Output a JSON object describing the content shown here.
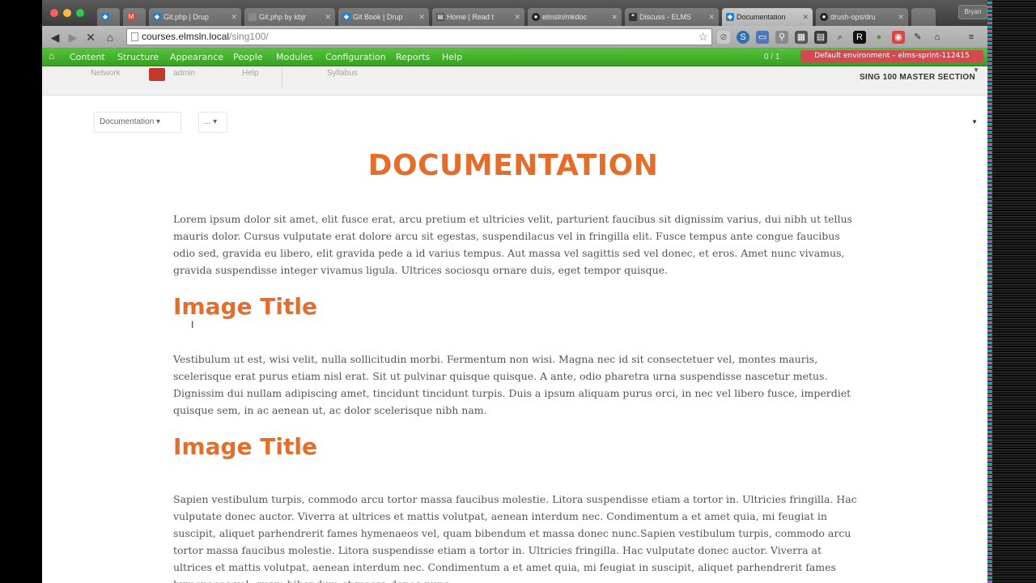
{
  "browser": {
    "tabs": [
      {
        "label": "",
        "favicon": "drupal-icon",
        "color": "#2a7fbf"
      },
      {
        "label": "",
        "favicon": "gmail-icon",
        "color": "#d14836"
      },
      {
        "label": "Git.php | Drup",
        "favicon": "drupal-icon",
        "color": "#2a7fbf"
      },
      {
        "label": "Git.php by kbjr",
        "favicon": "page-icon",
        "color": "#888888"
      },
      {
        "label": "Git Book | Drup",
        "favicon": "drupal-icon",
        "color": "#2a7fbf"
      },
      {
        "label": "Home | Read t",
        "favicon": "book-icon",
        "color": "#555555"
      },
      {
        "label": "elmsln/mkdoc",
        "favicon": "github-icon",
        "color": "#222222"
      },
      {
        "label": "Discuss - ELMS",
        "favicon": "discuss-icon",
        "color": "#333333"
      },
      {
        "label": "Documentation",
        "favicon": "drupal-icon",
        "color": "#2a7fbf"
      },
      {
        "label": "drush-ops/dru",
        "favicon": "github-icon",
        "color": "#222222"
      }
    ],
    "user_chip": "Bryan",
    "url_host": "courses.elmsln.local",
    "url_path": "/sing100/"
  },
  "admin_menu": {
    "items": [
      "Content",
      "Structure",
      "Appearance",
      "People",
      "Modules",
      "Configuration",
      "Reports",
      "Help"
    ],
    "count": "0 / 1",
    "environment": "Default environment – elms-sprint-112415"
  },
  "elms_bar": {
    "network": "Network",
    "admin": "admin",
    "help": "Help",
    "syllabus": "Syllabus",
    "section": "SING 100 MASTER SECTION"
  },
  "content": {
    "dropdown_documentation": "Documentation ▾",
    "dropdown_more": "... ▾",
    "title": "DOCUMENTATION",
    "paragraph1": "Lorem ipsum dolor sit amet, elit fusce erat, arcu pretium et ultricies velit, parturient faucibus sit dignissim varius, dui nibh ut tellus mauris dolor. Cursus vulputate erat dolore arcu sit egestas, suspendilacus vel in fringilla elit. Fusce tempus ante congue faucibus odio sed, gravida eu libero, elit gravida pede a id varius tempus. Aut massa vel sagittis sed vel donec, et eros. Amet nunc vivamus, gravida suspendisse integer vivamus ligula. Ultrices sociosqu ornare duis, eget tempor quisque.",
    "image_title_1": "Image Title",
    "paragraph2": "Vestibulum ut est, wisi velit, nulla sollicitudin morbi. Fermentum non wisi. Magna nec id sit consectetuer vel, montes mauris, scelerisque erat purus etiam nisl erat. Sit ut pulvinar quisque quisque. A ante, odio pharetra urna suspendisse nascetur metus. Dignissim dui nullam adipiscing amet, tincidunt tincidunt turpis. Duis a ipsum aliquam purus orci, in nec vel libero fusce, imperdiet quisque sem, in ac aenean ut, ac dolor scelerisque nibh nam.",
    "image_title_2": "Image Title",
    "paragraph3": "Sapien vestibulum turpis, commodo arcu tortor massa faucibus molestie. Litora suspendisse etiam a tortor in. Ultricies fringilla. Hac vulputate donec auctor. Viverra at ultrices et mattis volutpat, aenean interdum nec. Condimentum a et amet quia, mi feugiat in suscipit, aliquet parhendrerit fames hymenaeos vel, quam bibendum et massa donec nunc.Sapien vestibulum turpis, commodo arcu tortor massa faucibus molestie. Litora suspendisse etiam a tortor in. Ultricies fringilla. Hac vulputate donec auctor. Viverra at ultrices et mattis volutpat, aenean interdum nec. Condimentum a et amet quia, mi feugiat in suscipit, aliquet parhendrerit fames hymenaeos vel, quam bibendum et massa donec nunc."
  },
  "colors": {
    "accent_orange": "#e56d2b",
    "admin_green": "#3fae2a",
    "env_red": "#d14a4f"
  }
}
